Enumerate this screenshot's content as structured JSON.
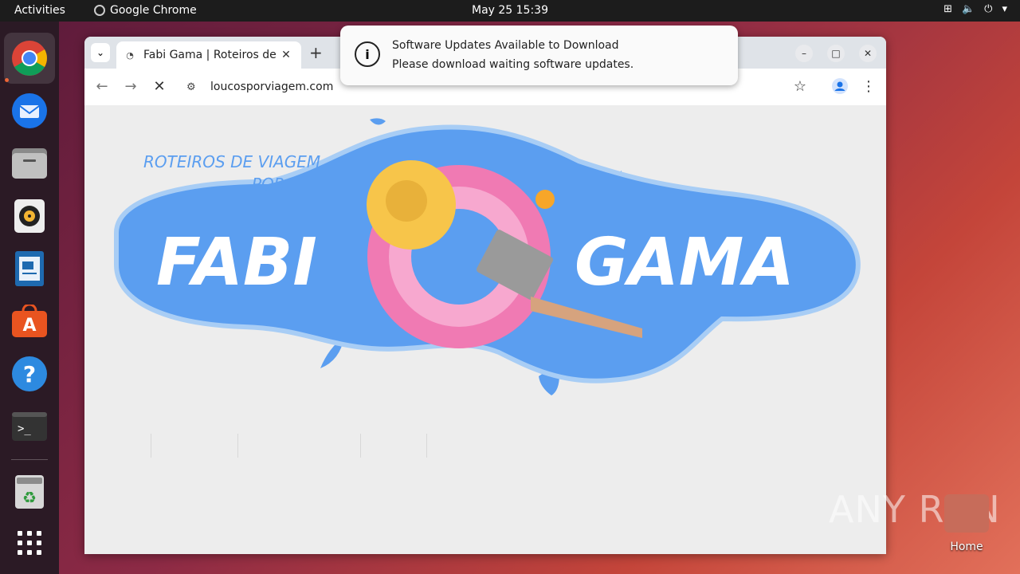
{
  "topbar": {
    "activities": "Activities",
    "app_name": "Google Chrome",
    "clock": "May 25  15:39"
  },
  "dock": {
    "items": [
      "chrome-icon",
      "thunderbird-icon",
      "files-icon",
      "rhythmbox-icon",
      "writer-icon",
      "app-center-icon",
      "help-icon",
      "terminal-icon",
      "trash-icon",
      "show-apps-icon"
    ]
  },
  "browser": {
    "tab_title": "Fabi Gama | Roteiros de V",
    "url": "loucosporviagem.com"
  },
  "page": {
    "logo_line1": "ROTEIROS DE VIAGEM",
    "logo_line2": "POR",
    "logo_left": "FABI",
    "logo_right": "GAMA"
  },
  "notification": {
    "title": "Software Updates Available to Download",
    "body": "Please download waiting software updates."
  },
  "desktop": {
    "home_label": "Home",
    "watermark": "ANY RUN"
  },
  "colors": {
    "pool": "#5b9ef0",
    "pool_edge": "#a8cdf5",
    "float_pink": "#f07ab3",
    "hat": "#f7c54a"
  }
}
